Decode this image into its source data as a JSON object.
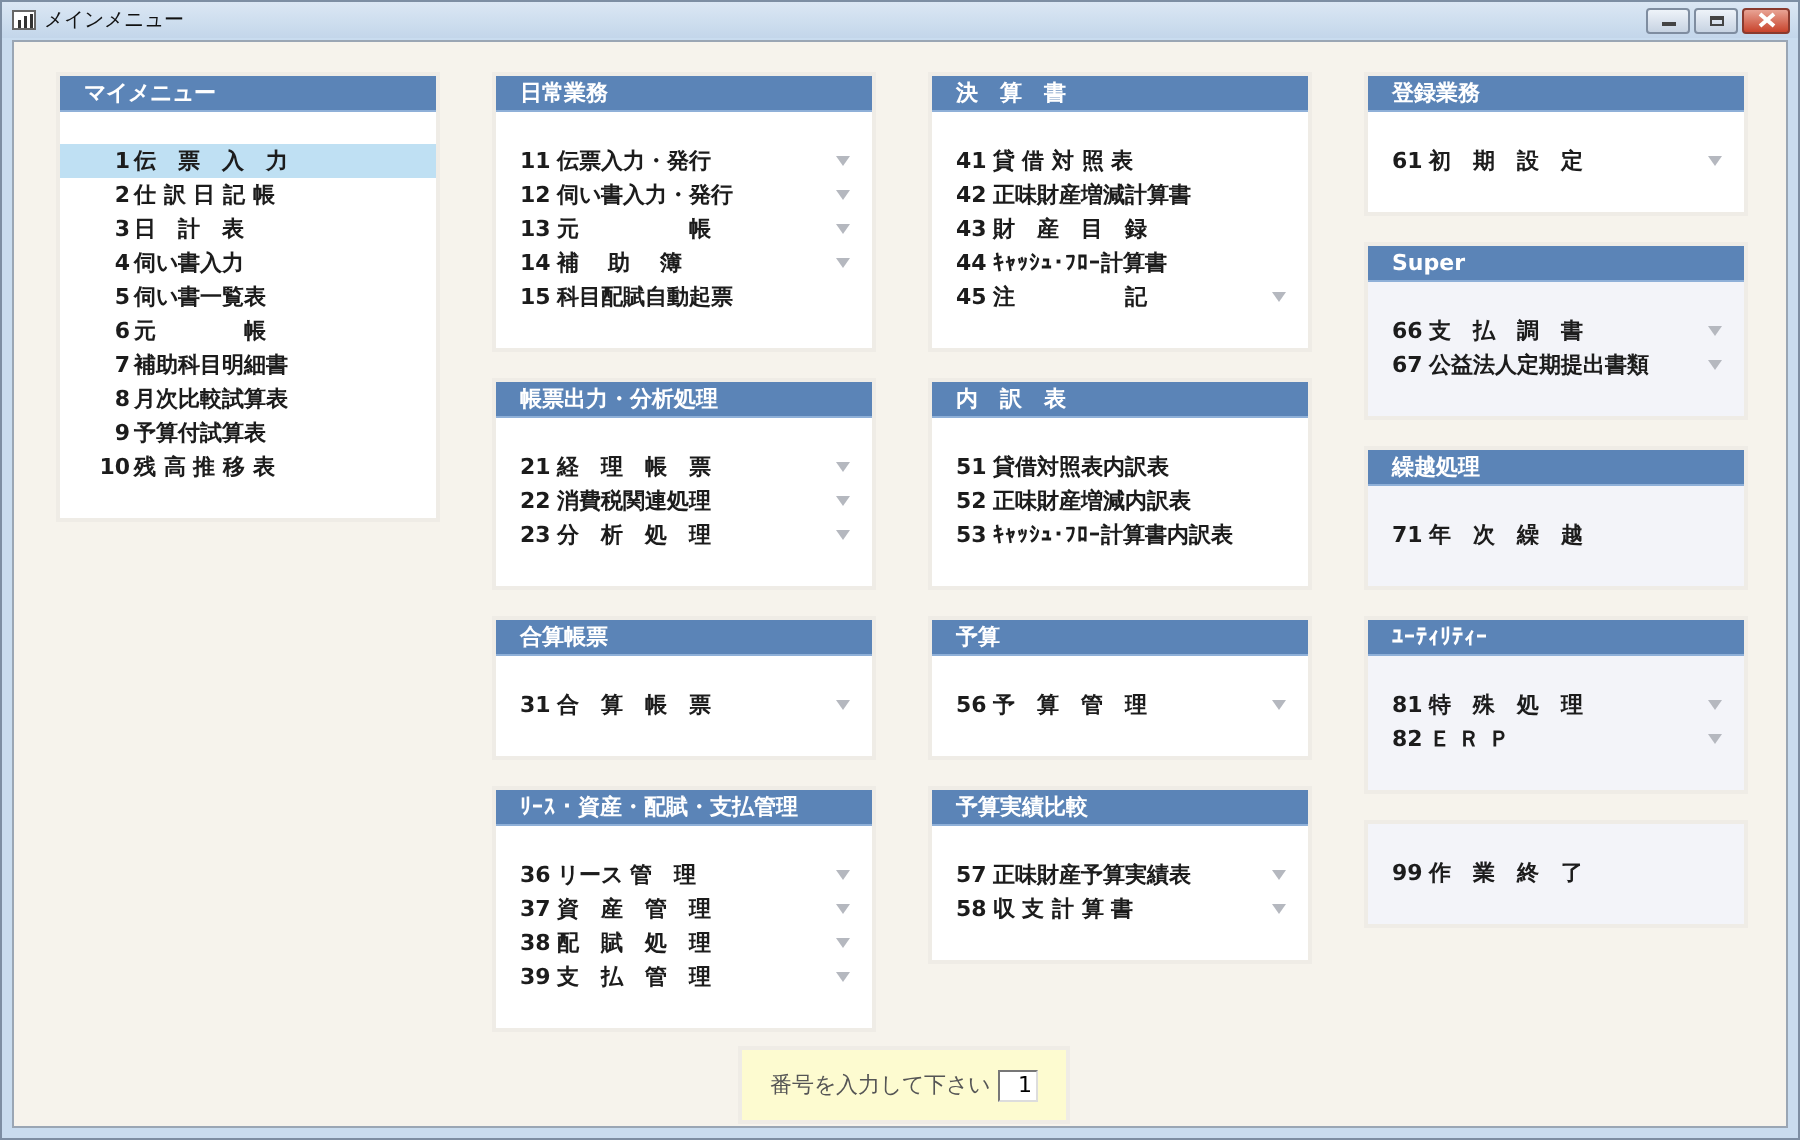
{
  "window": {
    "title": "メインメニュー"
  },
  "my_menu": {
    "title": "マイメニュー",
    "items": [
      {
        "number": "1",
        "label": "伝　票　入　力",
        "selected": true
      },
      {
        "number": "2",
        "label": "仕 訳 日 記 帳",
        "selected": false
      },
      {
        "number": "3",
        "label": "日　計　表",
        "selected": false
      },
      {
        "number": "4",
        "label": "伺い書入力",
        "selected": false
      },
      {
        "number": "5",
        "label": "伺い書一覧表",
        "selected": false
      },
      {
        "number": "6",
        "label": "元　　　　帳",
        "selected": false
      },
      {
        "number": "7",
        "label": "補助科目明細書",
        "selected": false
      },
      {
        "number": "8",
        "label": "月次比較試算表",
        "selected": false
      },
      {
        "number": "9",
        "label": "予算付試算表",
        "selected": false
      },
      {
        "number": "10",
        "label": "残 高 推 移 表",
        "selected": false
      }
    ]
  },
  "columns": [
    {
      "panels": [
        {
          "title": "日常業務",
          "tinted": false,
          "items": [
            {
              "number": "11",
              "label": "伝票入力・発行",
              "submenu": true
            },
            {
              "number": "12",
              "label": "伺い書入力・発行",
              "submenu": true
            },
            {
              "number": "13",
              "label": "元　　　　　帳",
              "submenu": true
            },
            {
              "number": "14",
              "label": "補　 助　 簿",
              "submenu": true
            },
            {
              "number": "15",
              "label": "科目配賦自動起票",
              "submenu": false
            }
          ]
        },
        {
          "title": "帳票出力・分析処理",
          "tinted": false,
          "items": [
            {
              "number": "21",
              "label": "経　理　帳　票",
              "submenu": true
            },
            {
              "number": "22",
              "label": "消費税関連処理",
              "submenu": true
            },
            {
              "number": "23",
              "label": "分　析　処　理",
              "submenu": true
            }
          ]
        },
        {
          "title": "合算帳票",
          "tinted": false,
          "items": [
            {
              "number": "31",
              "label": "合　算　帳　票",
              "submenu": true
            }
          ]
        },
        {
          "title": "ﾘｰｽ・資産・配賦・支払管理",
          "tinted": false,
          "items": [
            {
              "number": "36",
              "label": "リース 管　理",
              "submenu": true
            },
            {
              "number": "37",
              "label": "資　産　管　理",
              "submenu": true
            },
            {
              "number": "38",
              "label": "配　賦　処　理",
              "submenu": true
            },
            {
              "number": "39",
              "label": "支　払　管　理",
              "submenu": true
            }
          ]
        }
      ]
    },
    {
      "panels": [
        {
          "title": "決　算　書",
          "tinted": false,
          "items": [
            {
              "number": "41",
              "label": "貸 借 対 照 表",
              "submenu": false
            },
            {
              "number": "42",
              "label": "正味財産増減計算書",
              "submenu": false
            },
            {
              "number": "43",
              "label": "財　産　目　録",
              "submenu": false
            },
            {
              "number": "44",
              "label": "ｷｬｯｼｭ･ﾌﾛｰ計算書",
              "submenu": false
            },
            {
              "number": "45",
              "label": "注　　　　　記",
              "submenu": true
            }
          ]
        },
        {
          "title": "内　訳　表",
          "tinted": false,
          "items": [
            {
              "number": "51",
              "label": "貸借対照表内訳表",
              "submenu": false
            },
            {
              "number": "52",
              "label": "正味財産増減内訳表",
              "submenu": false
            },
            {
              "number": "53",
              "label": "ｷｬｯｼｭ･ﾌﾛｰ計算書内訳表",
              "submenu": false
            }
          ]
        },
        {
          "title": "予算",
          "tinted": false,
          "items": [
            {
              "number": "56",
              "label": "予　算　管　理",
              "submenu": true
            }
          ]
        },
        {
          "title": "予算実績比較",
          "tinted": false,
          "items": [
            {
              "number": "57",
              "label": "正味財産予算実績表",
              "submenu": true
            },
            {
              "number": "58",
              "label": "収 支 計 算 書",
              "submenu": true
            }
          ]
        }
      ]
    },
    {
      "panels": [
        {
          "title": "登録業務",
          "tinted": false,
          "items": [
            {
              "number": "61",
              "label": "初　期　設　定",
              "submenu": true
            }
          ]
        },
        {
          "title": "Super",
          "tinted": true,
          "items": [
            {
              "number": "66",
              "label": "支　払　調　書",
              "submenu": true
            },
            {
              "number": "67",
              "label": "公益法人定期提出書類",
              "submenu": true
            }
          ]
        },
        {
          "title": "繰越処理",
          "tinted": true,
          "items": [
            {
              "number": "71",
              "label": "年　次　繰　越",
              "submenu": false
            }
          ]
        },
        {
          "title": "ﾕｰﾃｨﾘﾃｨｰ",
          "tinted": true,
          "items": [
            {
              "number": "81",
              "label": "特　殊　処　理",
              "submenu": true
            },
            {
              "number": "82",
              "label": "Ｅ Ｒ Ｐ",
              "submenu": true
            }
          ]
        },
        {
          "tinted": true,
          "items": [
            {
              "number": "99",
              "label": "作　業　終　了",
              "submenu": false
            }
          ]
        }
      ]
    }
  ],
  "number_entry": {
    "label": "番号を入力して下さい",
    "value": "1"
  }
}
